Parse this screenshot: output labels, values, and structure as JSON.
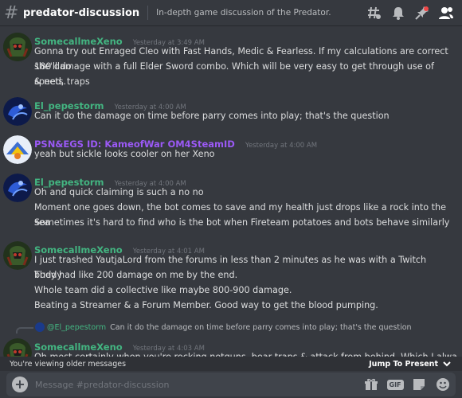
{
  "header": {
    "channel_name": "predator-discussion",
    "topic": "In-depth game discussion of the Predator."
  },
  "messages": [
    {
      "author": "SomecallmeXeno",
      "author_color": "#43b581",
      "timestamp": "Yesterday at 3:49 AM",
      "lines": [
        "Gonna try out Enraged Cleo with Fast Hands, Medic & Fearless. If my calculations are correct she'll do",
        "180 damage with a full Elder Sword combo. Which will be very easy to get through use of speed, traps",
        "& nets."
      ]
    },
    {
      "author": "El_pepestorm",
      "author_color": "#43b581",
      "timestamp": "Yesterday at 4:00 AM",
      "lines": [
        "Can it do the damage on time before parry comes into play; that's the question"
      ]
    },
    {
      "author": "PSN&EGS ID: KameofWar OM4SteamID",
      "author_color": "#9b59f6",
      "timestamp": "Yesterday at 4:00 AM",
      "lines": [
        "yeah but sickle looks cooler on her Xeno"
      ]
    },
    {
      "author": "El_pepestorm",
      "author_color": "#43b581",
      "timestamp": "Yesterday at 4:00 AM",
      "lines": [
        "Oh and quick claiming is such a no no",
        "Moment one goes down, the bot comes to save and my health just drops like a rock into the sea",
        "Sometimes it's hard to find who is the bot when Fireteam potatoes and bots behave similarly"
      ]
    },
    {
      "author": "SomecallmeXeno",
      "author_color": "#43b581",
      "timestamp": "Yesterday at 4:01 AM",
      "lines": [
        "I just trashed YautjaLord from the forums in less than 2 minutes as he was with a Twitch buddy",
        "They had like 200 damage on me by the end.",
        "Whole team did a collective like maybe 800-900 damage.",
        "Beating a Streamer & a Forum Member. Good way to get the blood pumping."
      ]
    },
    {
      "reply": {
        "author": "@El_pepestorm",
        "text": "Can it do the damage on time before parry comes into play; that's the question"
      },
      "author": "SomecallmeXeno",
      "author_color": "#43b581",
      "timestamp": "Yesterday at 4:03 AM",
      "lines": [
        "Oh most certainly when you're rocking netguns, bear traps & attack from behind. Which I always do"
      ]
    }
  ],
  "older_bar": {
    "text": "You're viewing older messages",
    "jump_label": "Jump To Present"
  },
  "input": {
    "placeholder": "Message #predator-discussion",
    "gif_label": "GIF"
  },
  "icons": [
    "threads-icon",
    "bell-icon",
    "pin-icon",
    "members-icon",
    "gift-icon",
    "gif-icon",
    "sticker-icon",
    "emoji-icon"
  ]
}
